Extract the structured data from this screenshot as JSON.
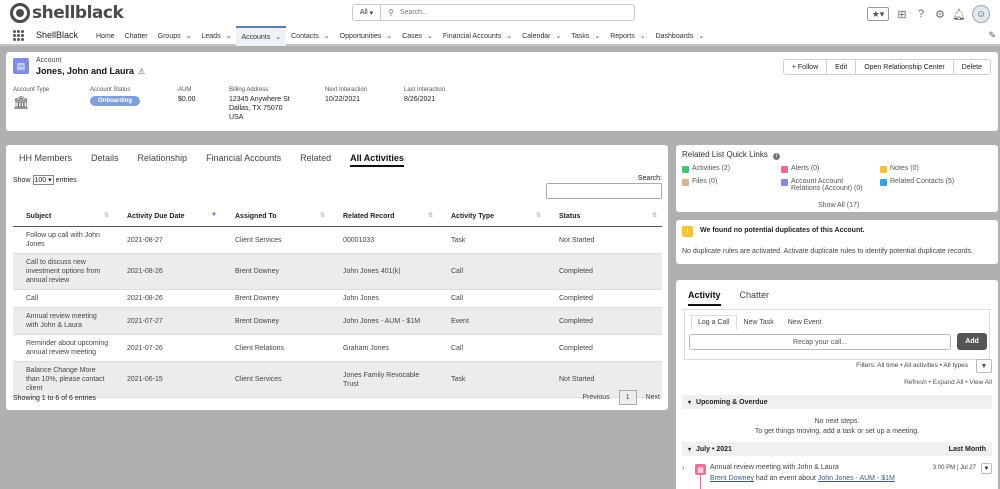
{
  "top": {
    "logo_text": "shellblack",
    "search_scope": "All",
    "search_placeholder": "Search..."
  },
  "nav": {
    "app_name": "ShellBlack",
    "items": [
      {
        "label": "Home",
        "dropdown": false
      },
      {
        "label": "Chatter",
        "dropdown": false
      },
      {
        "label": "Groups",
        "dropdown": true
      },
      {
        "label": "Leads",
        "dropdown": true
      },
      {
        "label": "Accounts",
        "dropdown": true,
        "active": true
      },
      {
        "label": "Contacts",
        "dropdown": true
      },
      {
        "label": "Opportunities",
        "dropdown": true
      },
      {
        "label": "Cases",
        "dropdown": true
      },
      {
        "label": "Financial Accounts",
        "dropdown": true
      },
      {
        "label": "Calendar",
        "dropdown": true
      },
      {
        "label": "Tasks",
        "dropdown": true
      },
      {
        "label": "Reports",
        "dropdown": true
      },
      {
        "label": "Dashboards",
        "dropdown": true
      }
    ]
  },
  "header": {
    "object_type": "Account",
    "name": "Jones, John and Laura",
    "buttons": {
      "follow": "+ Follow",
      "edit": "Edit",
      "open_center": "Open Relationship Center",
      "delete": "Delete"
    },
    "fields": {
      "account_type_label": "Account Type",
      "account_status_label": "Account Status",
      "account_status_value": "Onboarding",
      "aum_label": "AUM",
      "aum_value": "$0.00",
      "billing_label": "Billing Address",
      "billing_line1": "12345 Anywhere St",
      "billing_line2": "Dallas, TX 75070",
      "billing_line3": "USA",
      "next_label": "Next Interaction",
      "next_value": "10/22/2021",
      "last_label": "Last Interaction",
      "last_value": "8/26/2021"
    }
  },
  "main": {
    "tabs": [
      "HH Members",
      "Details",
      "Relationship",
      "Financial Accounts",
      "Related",
      "All Activities"
    ],
    "active_tab": "All Activities",
    "show_label": "Show",
    "show_value": "100",
    "entries_label": "entries",
    "search_label": "Search:",
    "columns": [
      "Subject",
      "Activity Due Date",
      "Assigned To",
      "Related Record",
      "Activity Type",
      "Status"
    ],
    "rows": [
      [
        "Follow up call with John Jones",
        "2021-08-27",
        "Client Services",
        "00001033",
        "Task",
        "Not Started"
      ],
      [
        "Call to discuss new investment options from annual review",
        "2021-08-26",
        "Brent Downey",
        "John Jones 401(k)",
        "Call",
        "Completed"
      ],
      [
        "Call",
        "2021-08-26",
        "Brent Downey",
        "John Jones",
        "Call",
        "Completed"
      ],
      [
        "Annual review meeting with John & Laura",
        "2021-07-27",
        "Brent Downey",
        "John Jones - AUM - $1M",
        "Event",
        "Completed"
      ],
      [
        "Reminder about upcoming annual review meeting",
        "2021-07-26",
        "Client Relations",
        "Graham Jones",
        "Call",
        "Completed"
      ],
      [
        "Balance Change More than 10%, please contact client",
        "2021-06-15",
        "Client Services",
        "Jones Family Revocable Trust",
        "Task",
        "Not Started"
      ]
    ],
    "info": "Showing 1 to 6 of 6 entries",
    "pager": {
      "previous": "Previous",
      "page": "1",
      "next": "Next"
    }
  },
  "quick_links": {
    "title": "Related List Quick Links",
    "items": [
      {
        "label": "Activities (2)",
        "color": "#4bc076"
      },
      {
        "label": "Alerts (0)",
        "color": "#e96c8b"
      },
      {
        "label": "Notes (0)",
        "color": "#f4c23a"
      },
      {
        "label": "Files (0)",
        "color": "#d9b48f"
      },
      {
        "label": "Account Account Relations (Account) (0)",
        "color": "#7f8de1"
      },
      {
        "label": "Related Contacts (5)",
        "color": "#3aa1e0"
      }
    ],
    "show_all": "Show All (17)"
  },
  "duplicates": {
    "title": "We found no potential duplicates of this Account.",
    "detail": "No duplicate rules are activated. Activate duplicate rules to identify potential duplicate records."
  },
  "activity": {
    "tabs": [
      "Activity",
      "Chatter"
    ],
    "subtabs": [
      "Log a Call",
      "New Task",
      "New Event"
    ],
    "recap_placeholder": "Recap your call...",
    "add": "Add",
    "filters": "Filters: All time • All activities • All types",
    "links": "Refresh • Expand All • View All",
    "upcoming": "Upcoming & Overdue",
    "no_steps_1": "No next steps.",
    "no_steps_2": "To get things moving, add a task or set up a meeting.",
    "month": "July • 2021",
    "last_month": "Last Month",
    "event_title": "Annual review meeting with John & Laura",
    "event_time": "3:00 PM | Jul 27",
    "event_owner": "Brent Downey",
    "event_mid": " had an event about ",
    "event_record": "John Jones - AUM - $1M"
  }
}
